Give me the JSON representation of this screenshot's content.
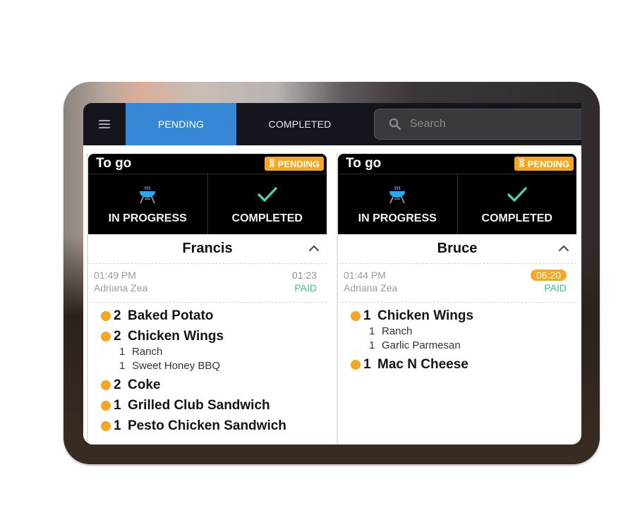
{
  "navbar": {
    "menu_icon": "hamburger-menu-icon",
    "tabs": [
      {
        "label": "PENDING",
        "active": true
      },
      {
        "label": "COMPLETED",
        "active": false
      }
    ],
    "search": {
      "placeholder": "Search",
      "value": "",
      "icon": "search-icon"
    }
  },
  "colors": {
    "active_tab": "#3687d6",
    "pending_badge": "#f5a623",
    "paid": "#37c193",
    "in_progress_icon": "#29a9ee",
    "completed_icon": "#4fd1a5",
    "item_dot": "#f5a623"
  },
  "orders": [
    {
      "type": "To go",
      "status": "PENDING",
      "status_icon": "hourglass-icon",
      "actions": [
        {
          "label": "IN PROGRESS",
          "icon": "grill-icon"
        },
        {
          "label": "COMPLETED",
          "icon": "checkmark-icon"
        }
      ],
      "customer": "Francis",
      "time": "01:49 PM",
      "server": "Adriana Zea",
      "elapsed": "01:23",
      "elapsed_alert": false,
      "payment": "PAID",
      "items": [
        {
          "qty": "2",
          "name": "Baked Potato",
          "mods": []
        },
        {
          "qty": "2",
          "name": "Chicken Wings",
          "mods": [
            {
              "qty": "1",
              "name": "Ranch"
            },
            {
              "qty": "1",
              "name": "Sweet Honey BBQ"
            }
          ]
        },
        {
          "qty": "2",
          "name": "Coke",
          "mods": []
        },
        {
          "qty": "1",
          "name": "Grilled Club Sandwich",
          "mods": []
        },
        {
          "qty": "1",
          "name": "Pesto Chicken Sandwich",
          "mods": []
        }
      ]
    },
    {
      "type": "To go",
      "status": "PENDING",
      "status_icon": "hourglass-icon",
      "actions": [
        {
          "label": "IN PROGRESS",
          "icon": "grill-icon"
        },
        {
          "label": "COMPLETED",
          "icon": "checkmark-icon"
        }
      ],
      "customer": "Bruce",
      "time": "01:44 PM",
      "server": "Adriana Zea",
      "elapsed": "06:20",
      "elapsed_alert": true,
      "payment": "PAID",
      "items": [
        {
          "qty": "1",
          "name": "Chicken Wings",
          "mods": [
            {
              "qty": "1",
              "name": "Ranch"
            },
            {
              "qty": "1",
              "name": "Garlic Parmesan"
            }
          ]
        },
        {
          "qty": "1",
          "name": "Mac N Cheese",
          "mods": []
        }
      ]
    }
  ]
}
